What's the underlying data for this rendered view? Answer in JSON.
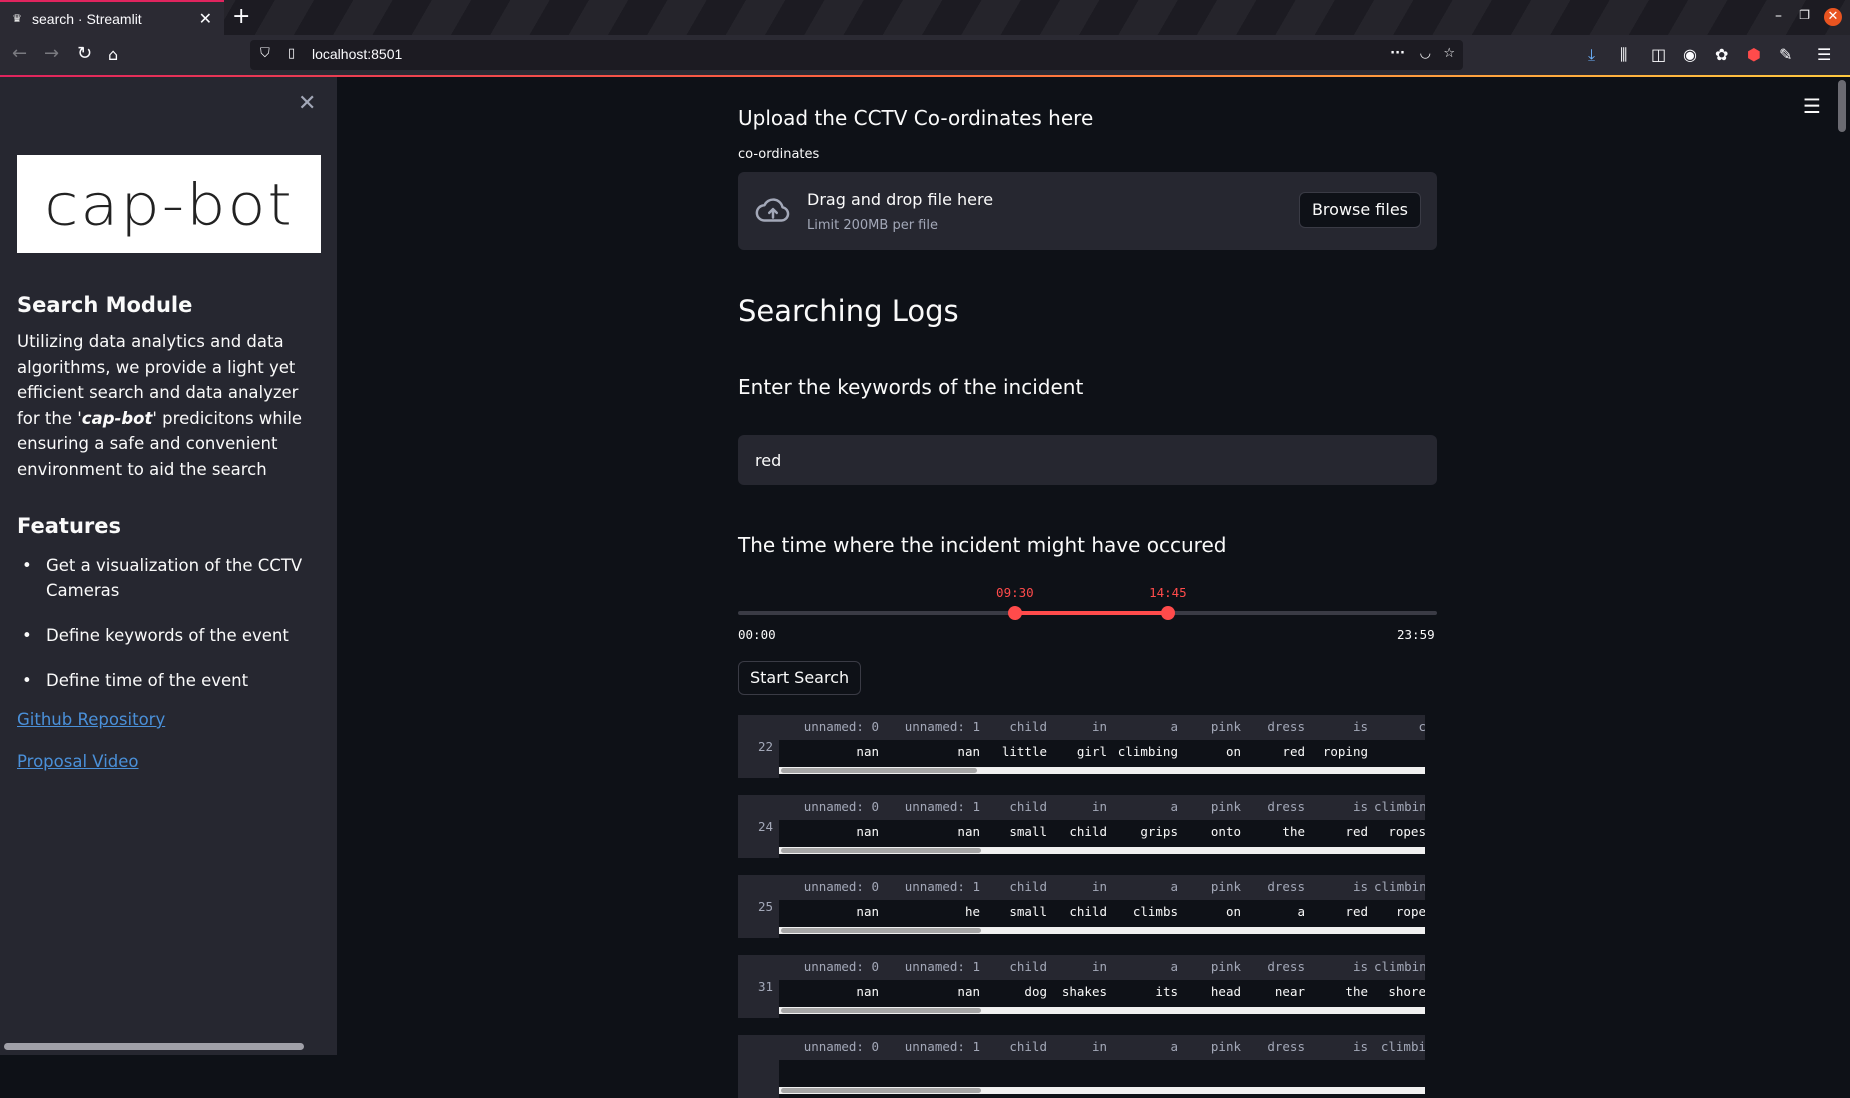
{
  "browser": {
    "tab_title": "search · Streamlit",
    "url": "localhost:8501"
  },
  "sidebar": {
    "logo_text": "cap-bot",
    "module_title": "Search Module",
    "description_before": "Utilizing data analytics and data algorithms, we provide a light yet efficient search and data analyzer for the '",
    "description_brand": "cap-bot",
    "description_after": "' predicitons while ensuring a safe and convenient environment to aid the search",
    "features_title": "Features",
    "features": [
      "Get a visualization of the CCTV Cameras",
      "Define keywords of the event",
      "Define time of the event"
    ],
    "links": [
      "Github Repository",
      "Proposal Video"
    ]
  },
  "main": {
    "upload_heading": "Upload the CCTV Co-ordinates here",
    "uploader_label": "co-ordinates",
    "drop_text": "Drag and drop file here",
    "drop_limit": "Limit 200MB per file",
    "browse_label": "Browse files",
    "search_heading": "Searching Logs",
    "keywords_heading": "Enter the keywords of the incident",
    "keywords_value": "red",
    "time_heading": "The time where the incident might have occured",
    "slider": {
      "min_label": "00:00",
      "max_label": "23:59",
      "low_label": "09:30",
      "high_label": "14:45",
      "min_minutes": 0,
      "max_minutes": 1439,
      "low_minutes": 570,
      "high_minutes": 885
    },
    "start_label": "Start Search"
  },
  "results": [
    {
      "index": "22",
      "headers": [
        "unnamed: 0",
        "unnamed: 1",
        "child",
        "in",
        "a",
        "pink",
        "dress",
        "is",
        "c"
      ],
      "values": [
        "nan",
        "nan",
        "little",
        "girl",
        "climbing",
        "on",
        "red",
        "roping",
        ""
      ]
    },
    {
      "index": "24",
      "headers": [
        "unnamed: 0",
        "unnamed: 1",
        "child",
        "in",
        "a",
        "pink",
        "dress",
        "is",
        "climbing"
      ],
      "values": [
        "nan",
        "nan",
        "small",
        "child",
        "grips",
        "onto",
        "the",
        "red",
        "ropes"
      ]
    },
    {
      "index": "25",
      "headers": [
        "unnamed: 0",
        "unnamed: 1",
        "child",
        "in",
        "a",
        "pink",
        "dress",
        "is",
        "climbin"
      ],
      "values": [
        "nan",
        "he",
        "small",
        "child",
        "climbs",
        "on",
        "a",
        "red",
        "rope"
      ]
    },
    {
      "index": "31",
      "headers": [
        "unnamed: 0",
        "unnamed: 1",
        "child",
        "in",
        "a",
        "pink",
        "dress",
        "is",
        "climbing"
      ],
      "values": [
        "nan",
        "nan",
        "dog",
        "shakes",
        "its",
        "head",
        "near",
        "the",
        "shore"
      ]
    },
    {
      "index": "",
      "headers": [
        "unnamed: 0",
        "unnamed: 1",
        "child",
        "in",
        "a",
        "pink",
        "dress",
        "is",
        "climbi"
      ],
      "values": [
        "",
        "",
        "",
        "",
        "",
        "",
        "",
        "",
        ""
      ]
    }
  ],
  "colors": {
    "accent": "#ff4b4b",
    "background": "#0e1117",
    "secondary_background": "#262730",
    "link": "#4a90d9"
  }
}
